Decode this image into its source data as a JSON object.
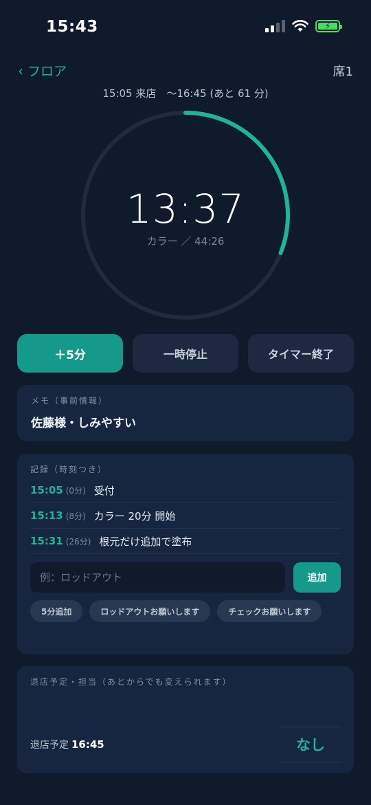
{
  "status_bar": {
    "time": "15:43"
  },
  "nav": {
    "back_label": "フロア",
    "seat": "席1"
  },
  "visit_info": "15:05 来店　～16:45 (あと 61 分)",
  "timer": {
    "display": "13:37",
    "sub": "カラー ／ 44:26",
    "progress": 0.31,
    "accent": "#1fb49a"
  },
  "actions": {
    "add5": "＋5分",
    "pause": "一時停止",
    "end": "タイマー終了"
  },
  "memo": {
    "title": "メモ（事前情報）",
    "text": "佐藤様・しみやすい"
  },
  "log": {
    "title": "記録（時刻つき）",
    "entries": [
      {
        "time": "15:05",
        "elapsed": "(0分)",
        "text": "受付"
      },
      {
        "time": "15:13",
        "elapsed": "(8分)",
        "text": "カラー 20分 開始"
      },
      {
        "time": "15:31",
        "elapsed": "(26分)",
        "text": "根元だけ追加で塗布"
      }
    ],
    "input_placeholder": "例：ロッドアウト",
    "add_label": "追加",
    "chips": [
      "5分追加",
      "ロッドアウトお願いします",
      "チェックお願いします"
    ]
  },
  "leave": {
    "title": "退店予定・担当（あとからでも変えられます）",
    "label": "退店予定",
    "time": "16:45",
    "staff": "なし"
  }
}
